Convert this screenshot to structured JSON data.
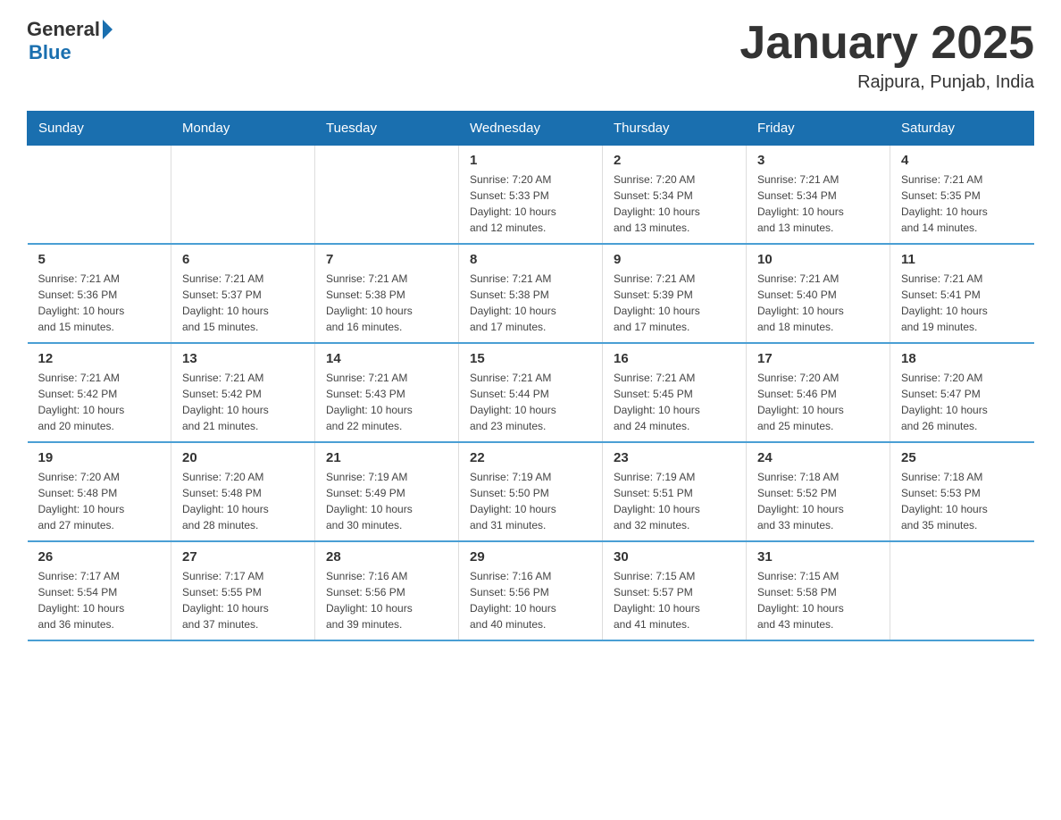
{
  "header": {
    "logo_general": "General",
    "logo_blue": "Blue",
    "month_title": "January 2025",
    "location": "Rajpura, Punjab, India"
  },
  "days_of_week": [
    "Sunday",
    "Monday",
    "Tuesday",
    "Wednesday",
    "Thursday",
    "Friday",
    "Saturday"
  ],
  "weeks": [
    [
      {
        "day": "",
        "info": ""
      },
      {
        "day": "",
        "info": ""
      },
      {
        "day": "",
        "info": ""
      },
      {
        "day": "1",
        "info": "Sunrise: 7:20 AM\nSunset: 5:33 PM\nDaylight: 10 hours\nand 12 minutes."
      },
      {
        "day": "2",
        "info": "Sunrise: 7:20 AM\nSunset: 5:34 PM\nDaylight: 10 hours\nand 13 minutes."
      },
      {
        "day": "3",
        "info": "Sunrise: 7:21 AM\nSunset: 5:34 PM\nDaylight: 10 hours\nand 13 minutes."
      },
      {
        "day": "4",
        "info": "Sunrise: 7:21 AM\nSunset: 5:35 PM\nDaylight: 10 hours\nand 14 minutes."
      }
    ],
    [
      {
        "day": "5",
        "info": "Sunrise: 7:21 AM\nSunset: 5:36 PM\nDaylight: 10 hours\nand 15 minutes."
      },
      {
        "day": "6",
        "info": "Sunrise: 7:21 AM\nSunset: 5:37 PM\nDaylight: 10 hours\nand 15 minutes."
      },
      {
        "day": "7",
        "info": "Sunrise: 7:21 AM\nSunset: 5:38 PM\nDaylight: 10 hours\nand 16 minutes."
      },
      {
        "day": "8",
        "info": "Sunrise: 7:21 AM\nSunset: 5:38 PM\nDaylight: 10 hours\nand 17 minutes."
      },
      {
        "day": "9",
        "info": "Sunrise: 7:21 AM\nSunset: 5:39 PM\nDaylight: 10 hours\nand 17 minutes."
      },
      {
        "day": "10",
        "info": "Sunrise: 7:21 AM\nSunset: 5:40 PM\nDaylight: 10 hours\nand 18 minutes."
      },
      {
        "day": "11",
        "info": "Sunrise: 7:21 AM\nSunset: 5:41 PM\nDaylight: 10 hours\nand 19 minutes."
      }
    ],
    [
      {
        "day": "12",
        "info": "Sunrise: 7:21 AM\nSunset: 5:42 PM\nDaylight: 10 hours\nand 20 minutes."
      },
      {
        "day": "13",
        "info": "Sunrise: 7:21 AM\nSunset: 5:42 PM\nDaylight: 10 hours\nand 21 minutes."
      },
      {
        "day": "14",
        "info": "Sunrise: 7:21 AM\nSunset: 5:43 PM\nDaylight: 10 hours\nand 22 minutes."
      },
      {
        "day": "15",
        "info": "Sunrise: 7:21 AM\nSunset: 5:44 PM\nDaylight: 10 hours\nand 23 minutes."
      },
      {
        "day": "16",
        "info": "Sunrise: 7:21 AM\nSunset: 5:45 PM\nDaylight: 10 hours\nand 24 minutes."
      },
      {
        "day": "17",
        "info": "Sunrise: 7:20 AM\nSunset: 5:46 PM\nDaylight: 10 hours\nand 25 minutes."
      },
      {
        "day": "18",
        "info": "Sunrise: 7:20 AM\nSunset: 5:47 PM\nDaylight: 10 hours\nand 26 minutes."
      }
    ],
    [
      {
        "day": "19",
        "info": "Sunrise: 7:20 AM\nSunset: 5:48 PM\nDaylight: 10 hours\nand 27 minutes."
      },
      {
        "day": "20",
        "info": "Sunrise: 7:20 AM\nSunset: 5:48 PM\nDaylight: 10 hours\nand 28 minutes."
      },
      {
        "day": "21",
        "info": "Sunrise: 7:19 AM\nSunset: 5:49 PM\nDaylight: 10 hours\nand 30 minutes."
      },
      {
        "day": "22",
        "info": "Sunrise: 7:19 AM\nSunset: 5:50 PM\nDaylight: 10 hours\nand 31 minutes."
      },
      {
        "day": "23",
        "info": "Sunrise: 7:19 AM\nSunset: 5:51 PM\nDaylight: 10 hours\nand 32 minutes."
      },
      {
        "day": "24",
        "info": "Sunrise: 7:18 AM\nSunset: 5:52 PM\nDaylight: 10 hours\nand 33 minutes."
      },
      {
        "day": "25",
        "info": "Sunrise: 7:18 AM\nSunset: 5:53 PM\nDaylight: 10 hours\nand 35 minutes."
      }
    ],
    [
      {
        "day": "26",
        "info": "Sunrise: 7:17 AM\nSunset: 5:54 PM\nDaylight: 10 hours\nand 36 minutes."
      },
      {
        "day": "27",
        "info": "Sunrise: 7:17 AM\nSunset: 5:55 PM\nDaylight: 10 hours\nand 37 minutes."
      },
      {
        "day": "28",
        "info": "Sunrise: 7:16 AM\nSunset: 5:56 PM\nDaylight: 10 hours\nand 39 minutes."
      },
      {
        "day": "29",
        "info": "Sunrise: 7:16 AM\nSunset: 5:56 PM\nDaylight: 10 hours\nand 40 minutes."
      },
      {
        "day": "30",
        "info": "Sunrise: 7:15 AM\nSunset: 5:57 PM\nDaylight: 10 hours\nand 41 minutes."
      },
      {
        "day": "31",
        "info": "Sunrise: 7:15 AM\nSunset: 5:58 PM\nDaylight: 10 hours\nand 43 minutes."
      },
      {
        "day": "",
        "info": ""
      }
    ]
  ]
}
